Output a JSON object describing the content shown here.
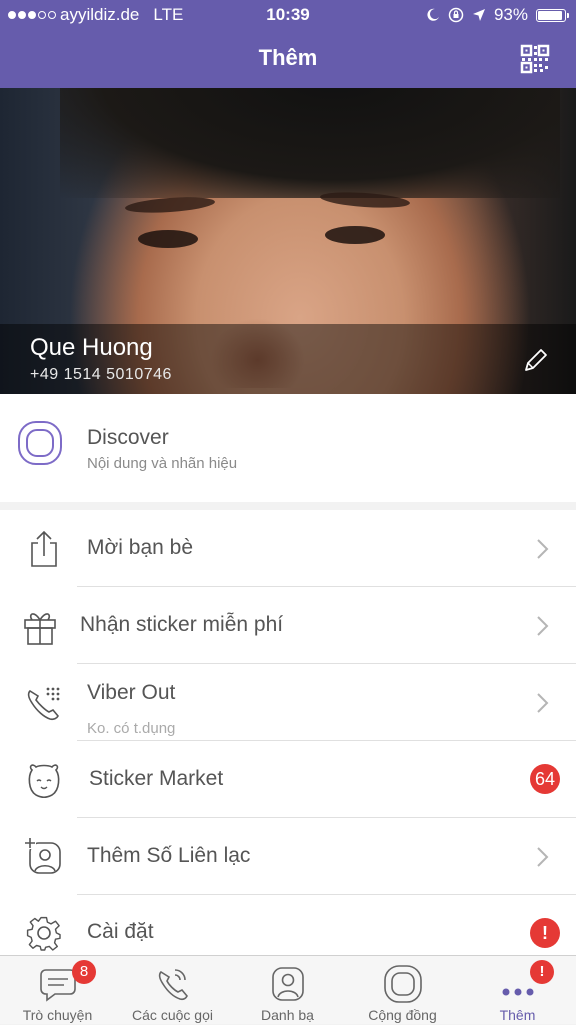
{
  "status_bar": {
    "carrier": "ayyildiz.de",
    "network": "LTE",
    "time": "10:39",
    "battery": "93%",
    "battery_level": 0.93
  },
  "nav": {
    "title": "Thêm",
    "qr_icon": "qr-code-icon"
  },
  "profile": {
    "name": "Que Huong",
    "phone": "+49 1514 5010746",
    "edit_icon": "pencil-icon"
  },
  "discover": {
    "title": "Discover",
    "subtitle": "Nội dung và nhãn hiệu",
    "icon": "discover-icon"
  },
  "menu": [
    {
      "label": "Mời bạn bè",
      "icon": "share-icon"
    },
    {
      "label": "Nhận sticker miễn phí",
      "icon": "gift-icon"
    },
    {
      "label": "Viber Out",
      "sublabel": "Ko. có t.dụng",
      "icon": "phone-keypad-icon"
    },
    {
      "label": "Sticker Market",
      "badge": "64",
      "icon": "bear-icon"
    },
    {
      "label": "Thêm Số Liên lạc",
      "icon": "add-contact-icon"
    },
    {
      "label": "Cài đặt",
      "badge": "!",
      "icon": "gear-icon"
    }
  ],
  "tabs": [
    {
      "label": "Trò chuyện",
      "badge": "8",
      "icon": "chat-icon"
    },
    {
      "label": "Các cuộc gọi",
      "icon": "call-icon"
    },
    {
      "label": "Danh bạ",
      "icon": "contacts-icon"
    },
    {
      "label": "Cộng đồng",
      "icon": "community-icon"
    },
    {
      "label": "Thêm",
      "badge": "!",
      "icon": "more-icon"
    }
  ],
  "colors": {
    "accent": "#665cac",
    "badge": "#e53935"
  }
}
